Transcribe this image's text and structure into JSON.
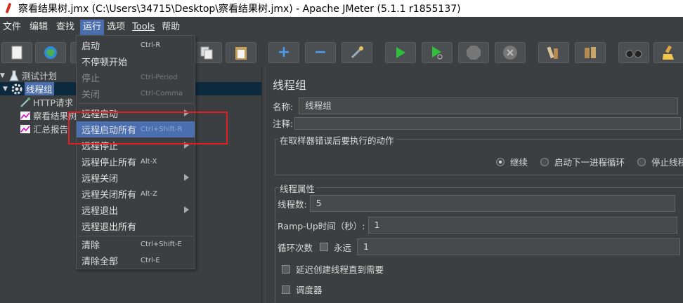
{
  "window": {
    "title": "察看结果树.jmx (C:\\Users\\34715\\Desktop\\察看结果树.jmx) - Apache JMeter (5.1.1 r1855137)"
  },
  "menubar": {
    "items": [
      {
        "label": "文件"
      },
      {
        "label": "编辑"
      },
      {
        "label": "查找"
      },
      {
        "label": "运行"
      },
      {
        "label": "选项"
      },
      {
        "label": "Tools"
      },
      {
        "label": "帮助"
      }
    ]
  },
  "toolbar": {
    "icons": [
      "new-icon",
      "templates-icon",
      "open-icon",
      "save-icon",
      "cut-icon",
      "copy-icon",
      "paste-icon",
      "expand-icon",
      "collapse-icon",
      "toggle-icon",
      "start-icon",
      "start-no-pause-icon",
      "stop-icon",
      "shutdown-icon",
      "clear-icon",
      "clear-all-icon",
      "search-icon",
      "reset-search-icon"
    ],
    "expand_glyph": "+",
    "collapse_glyph": "−"
  },
  "tree": {
    "items": [
      {
        "label": "测试计划"
      },
      {
        "label": "线程组"
      },
      {
        "label": "HTTP请求"
      },
      {
        "label": "察看结果树"
      },
      {
        "label": "汇总报告"
      }
    ]
  },
  "run_menu": {
    "items": [
      {
        "label": "启动",
        "shortcut": "Ctrl-R"
      },
      {
        "label": "不停顿开始",
        "shortcut": ""
      },
      {
        "label": "停止",
        "shortcut": "Ctrl-Period"
      },
      {
        "label": "关闭",
        "shortcut": "Ctrl-Comma"
      },
      {
        "label": "远程启动",
        "shortcut": ""
      },
      {
        "label": "远程启动所有",
        "shortcut": "Ctrl+Shift-R"
      },
      {
        "label": "远程停止",
        "shortcut": ""
      },
      {
        "label": "远程停止所有",
        "shortcut": "Alt-X"
      },
      {
        "label": "远程关闭",
        "shortcut": ""
      },
      {
        "label": "远程关闭所有",
        "shortcut": "Alt-Z"
      },
      {
        "label": "远程退出",
        "shortcut": ""
      },
      {
        "label": "远程退出所有",
        "shortcut": ""
      },
      {
        "label": "清除",
        "shortcut": "Ctrl+Shift-E"
      },
      {
        "label": "清除全部",
        "shortcut": "Ctrl-E"
      }
    ]
  },
  "thread_group": {
    "title": "线程组",
    "name_label": "名称:",
    "name_value": "线程组",
    "comment_label": "注释:",
    "comment_value": "",
    "error_action": {
      "legend": "在取样器错误后要执行的动作",
      "options": [
        "继续",
        "启动下一进程循环",
        "停止线程"
      ],
      "selected": "继续"
    },
    "properties": {
      "legend": "线程属性",
      "threads_label": "线程数:",
      "threads_value": "5",
      "rampup_label": "Ramp-Up时间（秒）:",
      "rampup_value": "1",
      "loop_label": "循环次数",
      "forever_label": "永远",
      "loop_value": "1",
      "delay_label": "延迟创建线程直到需要",
      "scheduler_label": "调度器"
    }
  },
  "colors": {
    "background": "#3c3f41",
    "selection": "#4b6eaf",
    "highlight_box": "#e02020"
  }
}
